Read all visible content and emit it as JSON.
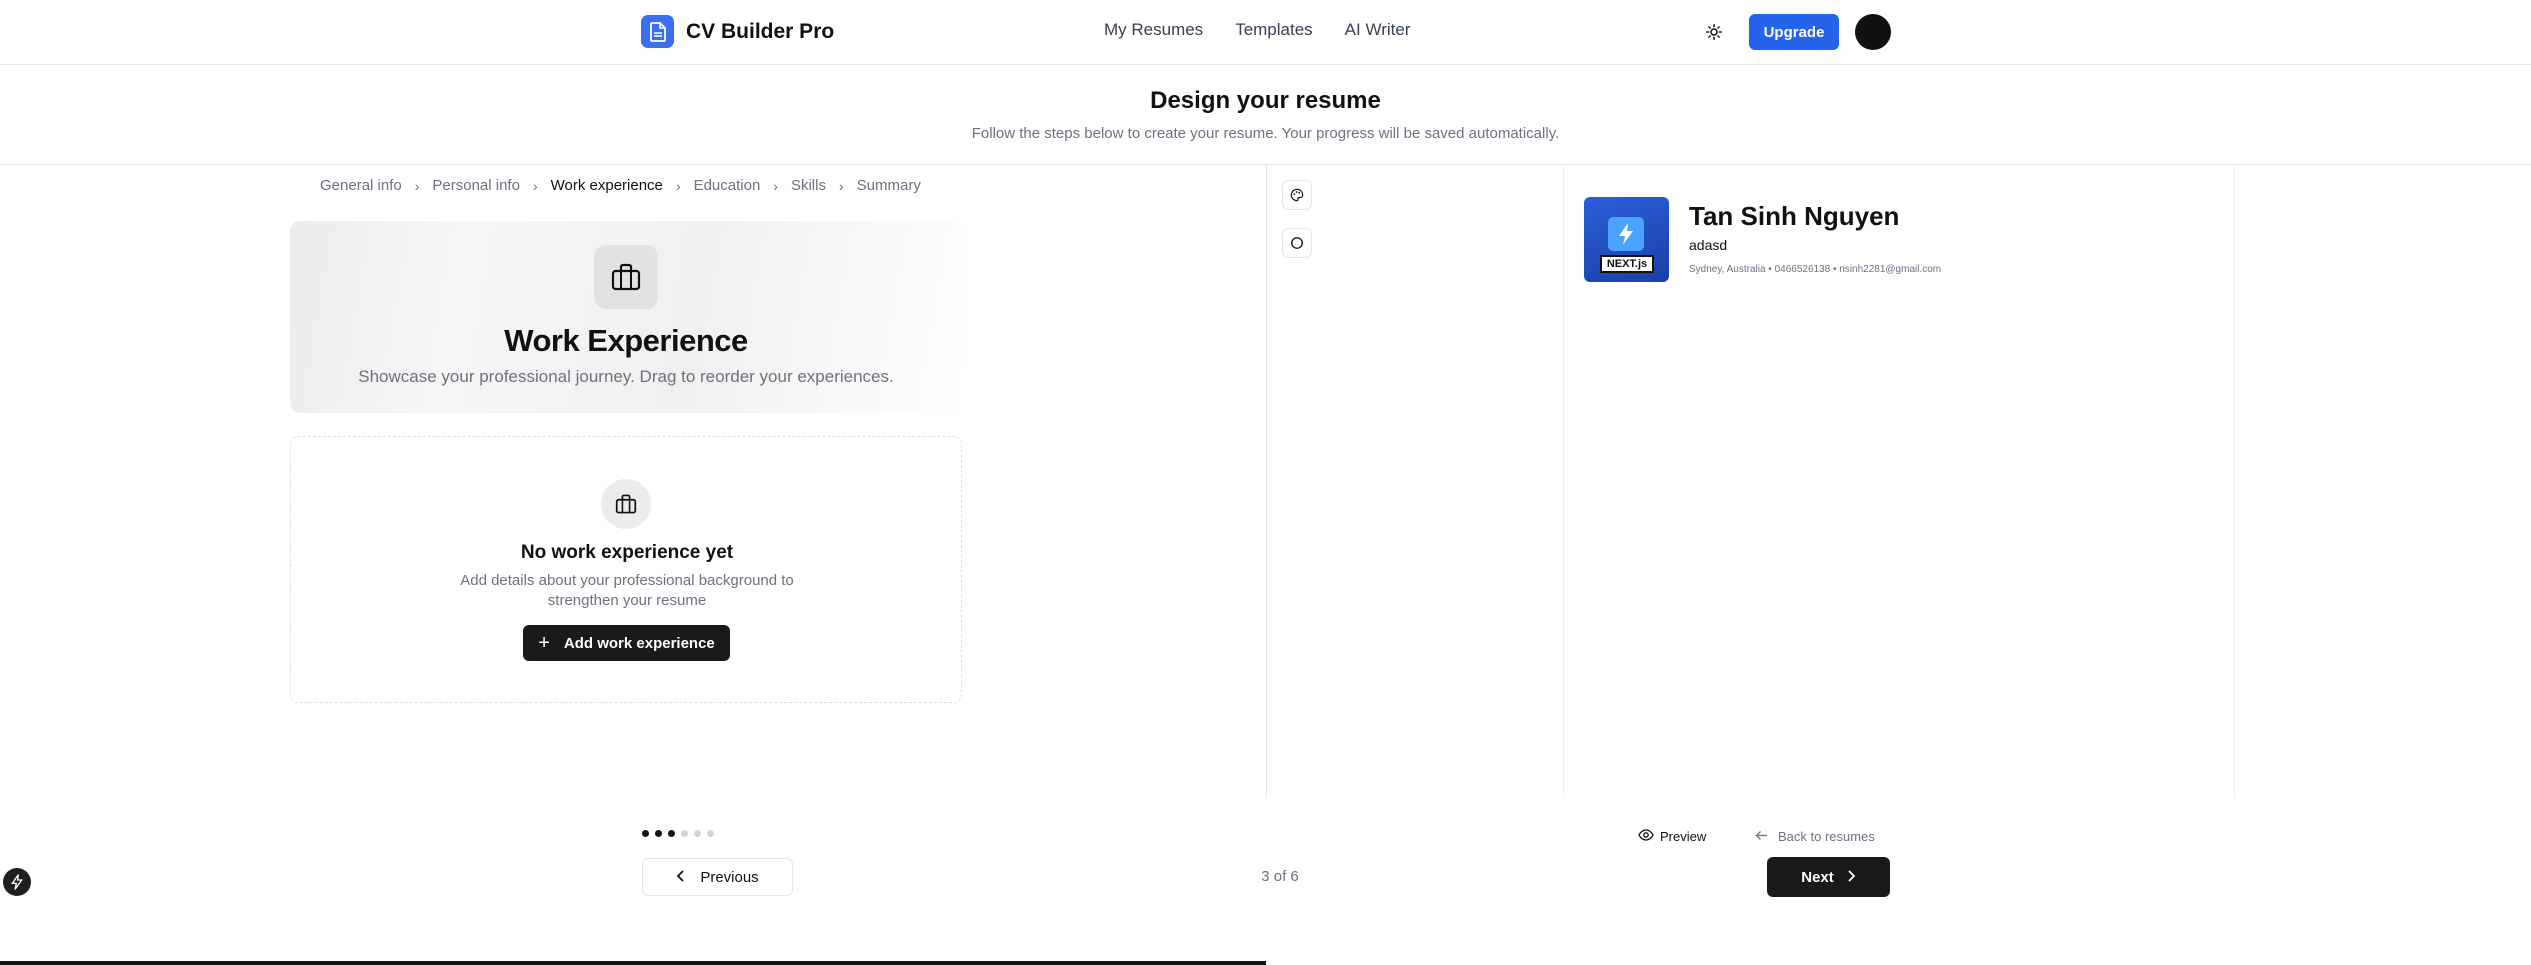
{
  "app": {
    "name": "CV Builder Pro",
    "nav": [
      "My Resumes",
      "Templates",
      "AI Writer"
    ],
    "upgrade_label": "Upgrade"
  },
  "header": {
    "title": "Design your resume",
    "subtitle": "Follow the steps below to create your resume. Your progress will be saved automatically."
  },
  "breadcrumb": {
    "steps": [
      "General info",
      "Personal info",
      "Work experience",
      "Education",
      "Skills",
      "Summary"
    ],
    "active_index": 2
  },
  "section": {
    "title": "Work Experience",
    "subtitle": "Showcase your professional journey. Drag to reorder your experiences."
  },
  "empty_state": {
    "title": "No work experience yet",
    "description": "Add details about your professional background to strengthen your resume",
    "button_label": "Add work experience"
  },
  "resume_preview": {
    "name": "Tan Sinh Nguyen",
    "job_title": "adasd",
    "contact": "Sydney, Australia • 0466526138 • nsinh2281@gmail.com",
    "photo_text": "NEXT.js"
  },
  "footer": {
    "previous_label": "Previous",
    "next_label": "Next",
    "step_counter": "3 of 6",
    "preview_label": "Preview",
    "back_label": "Back to resumes",
    "total_steps": 6,
    "completed_steps": 3
  },
  "colors": {
    "primary": "#2563eb",
    "brand_logo": "#3b6ff0",
    "dark_button": "#1a1a1a"
  }
}
